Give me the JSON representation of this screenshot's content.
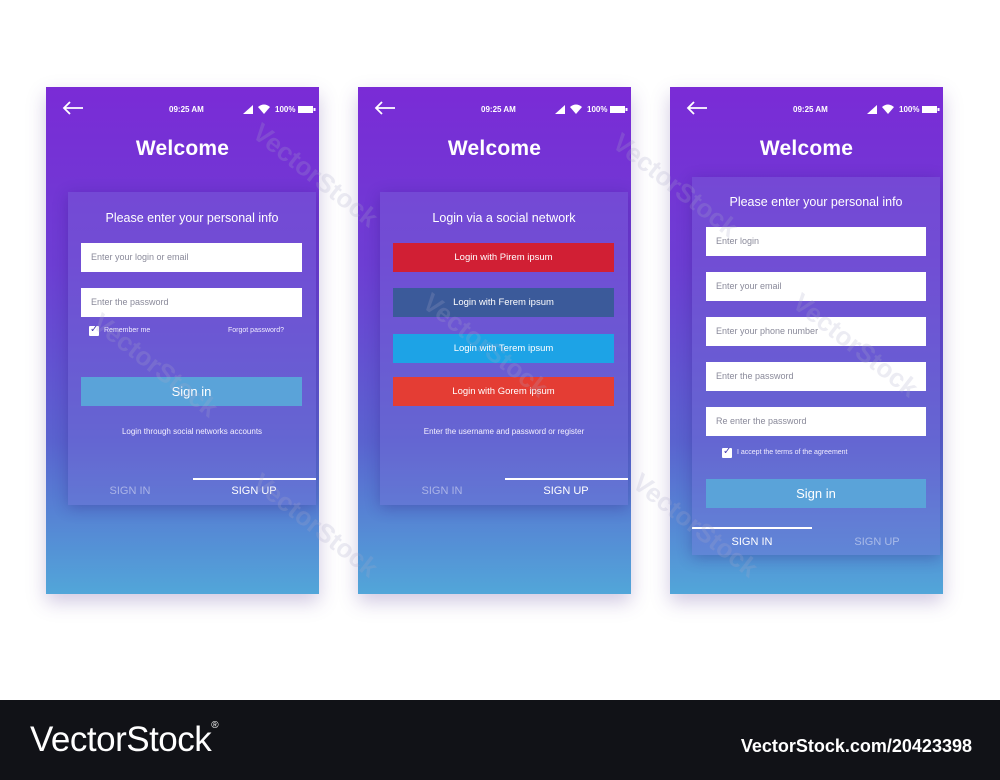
{
  "status": {
    "time": "09:25 AM",
    "battery": "100%"
  },
  "screens": [
    {
      "title": "Welcome",
      "card_title": "Please enter your personal info",
      "inputs": [
        "Enter your login or email",
        "Enter the password"
      ],
      "remember_label": "Remember me",
      "forgot_label": "Forgot password?",
      "signin_button": "Sign in",
      "hint": "Login through social networks accounts",
      "tabs": [
        "SIGN IN",
        "SIGN UP"
      ],
      "active_tab": "SIGN UP"
    },
    {
      "title": "Welcome",
      "card_title": "Login via a social network",
      "social_buttons": [
        {
          "label": "Login with Pirem ipsum",
          "color": "#d11f34"
        },
        {
          "label": "Login with Ferem ipsum",
          "color": "#3b5a9a"
        },
        {
          "label": "Login with Terem ipsum",
          "color": "#1da3e6"
        },
        {
          "label": "Login with Gorem ipsum",
          "color": "#e43d34"
        }
      ],
      "hint": "Enter the username and password or register",
      "tabs": [
        "SIGN IN",
        "SIGN UP"
      ],
      "active_tab": "SIGN UP"
    },
    {
      "title": "Welcome",
      "card_title": "Please enter your personal info",
      "inputs": [
        "Enter login",
        "Enter your email",
        "Enter your phone number",
        "Enter the password",
        "Re enter the password"
      ],
      "agreement_label": "I accept the terms of the agreement",
      "signin_button": "Sign in",
      "tabs": [
        "SIGN IN",
        "SIGN UP"
      ],
      "active_tab": "SIGN IN"
    }
  ],
  "watermark": "VectorStock",
  "footer": {
    "brand": "VectorStock",
    "registered": "®",
    "image_id": "VectorStock.com/20423398"
  },
  "icons": [
    "back-arrow-icon",
    "signal-icon",
    "wifi-icon",
    "battery-icon",
    "checkbox-check-icon"
  ],
  "colors": {
    "gradient_top": "#7a2bd6",
    "gradient_bottom": "#52a6d9",
    "signin_button": "#5aa3d9",
    "footer_bg": "#111217"
  }
}
